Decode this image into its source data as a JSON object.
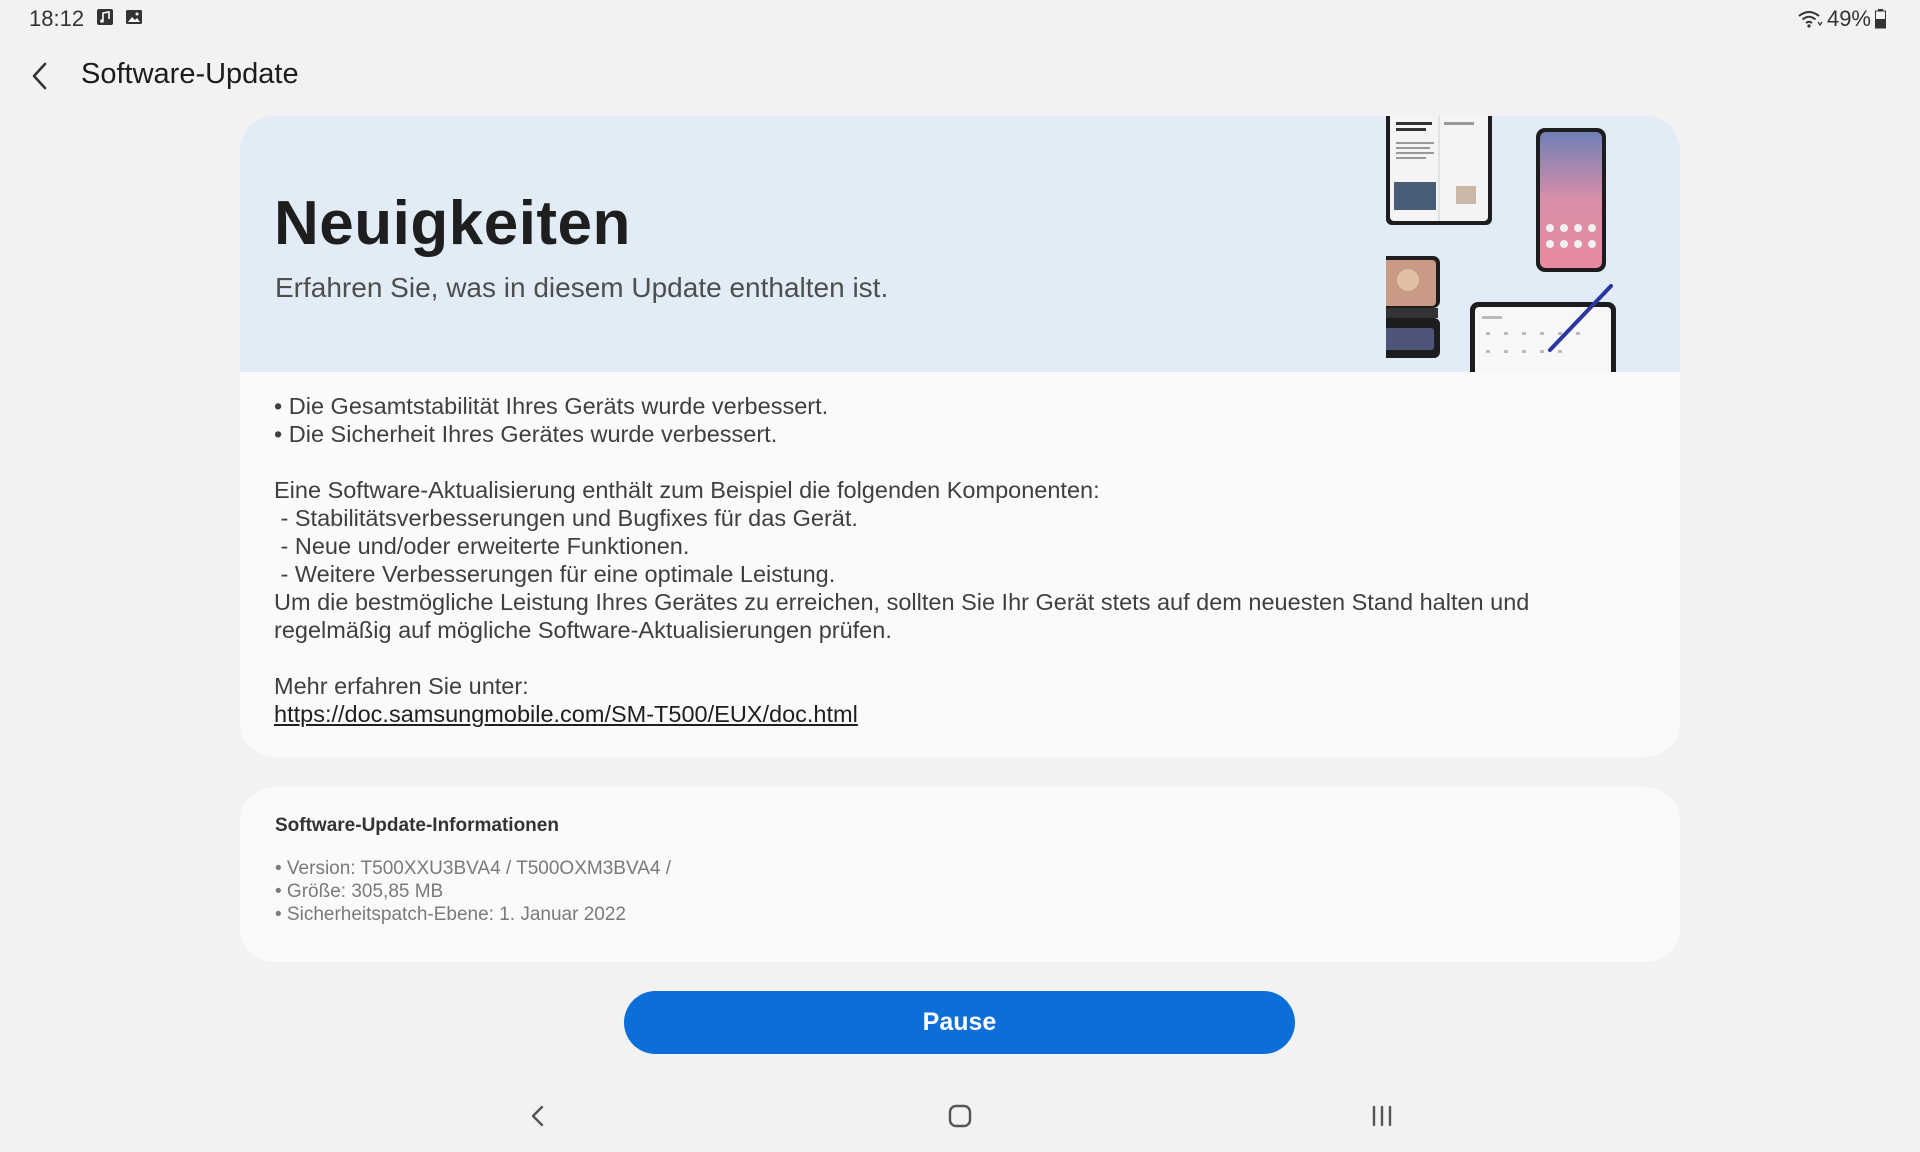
{
  "status_bar": {
    "time": "18:12",
    "battery": "49%"
  },
  "header": {
    "title": "Software-Update"
  },
  "news": {
    "title": "Neuigkeiten",
    "subtitle": "Erfahren Sie, was in diesem Update enthalten ist.",
    "body_lines": [
      "• Die Gesamtstabilität Ihres Geräts wurde verbessert.",
      "• Die Sicherheit Ihres Gerätes wurde verbessert.",
      "",
      "Eine Software-Aktualisierung enthält zum Beispiel die folgenden Komponenten:",
      " - Stabilitätsverbesserungen und Bugfixes für das Gerät.",
      " - Neue und/oder erweiterte Funktionen.",
      " - Weitere Verbesserungen für eine optimale Leistung.",
      "Um die bestmögliche Leistung Ihres Gerätes zu erreichen, sollten Sie Ihr Gerät stets auf dem neuesten Stand halten und",
      "regelmäßig auf mögliche Software-Aktualisierungen prüfen.",
      "",
      "Mehr erfahren Sie unter:"
    ],
    "link": "https://doc.samsungmobile.com/SM-T500/EUX/doc.html"
  },
  "info": {
    "title": "Software-Update-Informationen",
    "lines": [
      "• Version: T500XXU3BVA4 / T500OXM3BVA4 /",
      "• Größe: 305,85 MB",
      "• Sicherheitspatch-Ebene: 1. Januar 2022"
    ]
  },
  "actions": {
    "pause_label": "Pause"
  },
  "colors": {
    "accent": "#0b6ed9",
    "banner": "#e1ecf7",
    "background": "#f2f2f2"
  }
}
